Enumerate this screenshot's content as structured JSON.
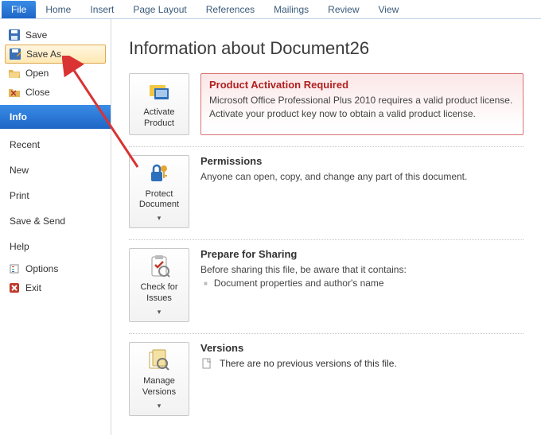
{
  "ribbon": {
    "tabs": [
      "File",
      "Home",
      "Insert",
      "Page Layout",
      "References",
      "Mailings",
      "Review",
      "View"
    ],
    "active": "File"
  },
  "sidebar": {
    "save": "Save",
    "save_as": "Save As",
    "open": "Open",
    "close": "Close",
    "info": "Info",
    "recent": "Recent",
    "new": "New",
    "print": "Print",
    "save_send": "Save & Send",
    "help": "Help",
    "options": "Options",
    "exit": "Exit"
  },
  "page_title": "Information about Document26",
  "activation": {
    "tile": "Activate Product",
    "heading": "Product Activation Required",
    "body": "Microsoft Office Professional Plus 2010 requires a valid product license. Activate your product key now to obtain a valid product license."
  },
  "permissions": {
    "tile": "Protect Document",
    "heading": "Permissions",
    "body": "Anyone can open, copy, and change any part of this document."
  },
  "sharing": {
    "tile": "Check for Issues",
    "heading": "Prepare for Sharing",
    "body": "Before sharing this file, be aware that it contains:",
    "item1": "Document properties and author's name"
  },
  "versions": {
    "tile": "Manage Versions",
    "heading": "Versions",
    "body": "There are no previous versions of this file."
  }
}
